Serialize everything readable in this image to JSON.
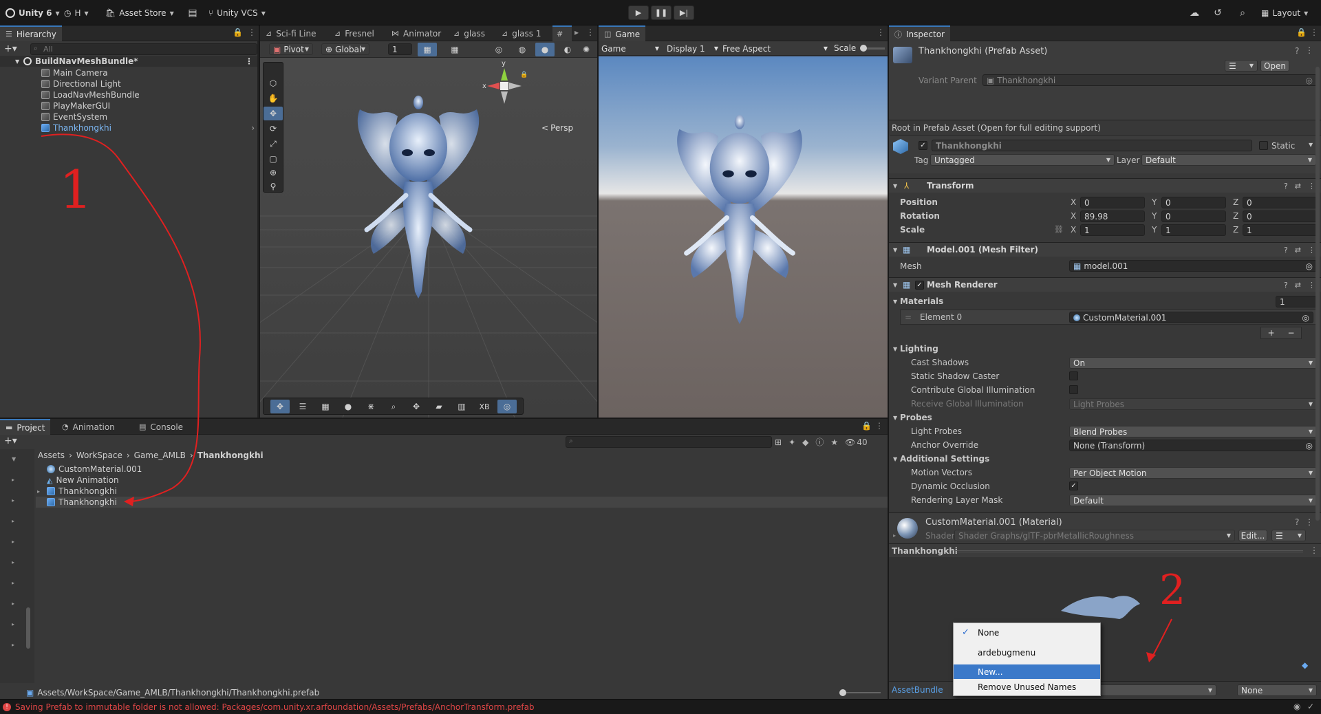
{
  "topbar": {
    "unity_label": "Unity 6",
    "account_label": "H",
    "asset_store": "Asset Store",
    "vcs_label": "Unity VCS",
    "layout_label": "Layout"
  },
  "hierarchy": {
    "tab_label": "Hierarchy",
    "search_placeholder": "All",
    "scene_name": "BuildNavMeshBundle*",
    "items": [
      {
        "label": "Main Camera"
      },
      {
        "label": "Directional Light"
      },
      {
        "label": "LoadNavMeshBundle"
      },
      {
        "label": "PlayMakerGUI"
      },
      {
        "label": "EventSystem"
      },
      {
        "label": "Thankhongkhi"
      }
    ]
  },
  "scene_tabs": [
    "Sci-fi Line",
    "Fresnel",
    "Animator",
    "glass",
    "glass 1"
  ],
  "scene": {
    "pivot": "Pivot",
    "global": "Global",
    "grid_value": "1",
    "persp_label": "Persp",
    "gizmo_y": "y",
    "gizmo_x": "x",
    "bottom_tools_label": "XB"
  },
  "game": {
    "tab_label": "Game",
    "mode": "Game",
    "display": "Display 1",
    "aspect": "Free Aspect",
    "scale_label": "Scale"
  },
  "project": {
    "tabs": [
      "Project",
      "Animation",
      "Console"
    ],
    "count": "40",
    "breadcrumb": [
      "Assets",
      "WorkSpace",
      "Game_AMLB",
      "Thankhongkhi"
    ],
    "files": [
      {
        "label": "CustomMaterial.001"
      },
      {
        "label": "New Animation"
      },
      {
        "label": "Thankhongkhi"
      },
      {
        "label": "Thankhongkhi"
      }
    ],
    "path": "Assets/WorkSpace/Game_AMLB/Thankhongkhi/Thankhongkhi.prefab"
  },
  "annotations": {
    "one": "1",
    "two": "2"
  },
  "inspector": {
    "tab_label": "Inspector",
    "title": "Thankhongkhi (Prefab Asset)",
    "open_button": "Open",
    "variant_parent_label": "Variant Parent",
    "variant_parent_value": "Thankhongkhi",
    "root_note": "Root in Prefab Asset (Open for full editing support)",
    "object_name": "Thankhongkhi",
    "static_label": "Static",
    "tag_label": "Tag",
    "tag_value": "Untagged",
    "layer_label": "Layer",
    "layer_value": "Default",
    "transform": {
      "title": "Transform",
      "position_label": "Position",
      "rotation_label": "Rotation",
      "scale_label": "Scale",
      "position": [
        "0",
        "0",
        "0"
      ],
      "rotation": [
        "89.98",
        "0",
        "0"
      ],
      "scale": [
        "1",
        "1",
        "1"
      ]
    },
    "mesh_filter": {
      "title": "Model.001 (Mesh Filter)",
      "mesh_label": "Mesh",
      "mesh_value": "model.001"
    },
    "mesh_renderer": {
      "title": "Mesh Renderer",
      "materials_label": "Materials",
      "materials_count": "1",
      "element_label": "Element 0",
      "element_value": "CustomMaterial.001",
      "lighting_label": "Lighting",
      "cast_shadows_label": "Cast Shadows",
      "cast_shadows_value": "On",
      "static_shadow_label": "Static Shadow Caster",
      "contribute_gi_label": "Contribute Global Illumination",
      "receive_gi_label": "Receive Global Illumination",
      "receive_gi_value": "Light Probes",
      "probes_label": "Probes",
      "light_probes_label": "Light Probes",
      "light_probes_value": "Blend Probes",
      "anchor_override_label": "Anchor Override",
      "anchor_override_value": "None (Transform)",
      "additional_label": "Additional Settings",
      "motion_vectors_label": "Motion Vectors",
      "motion_vectors_value": "Per Object Motion",
      "dynamic_occlusion_label": "Dynamic Occlusion",
      "rendering_layer_label": "Rendering Layer Mask",
      "rendering_layer_value": "Default"
    },
    "material": {
      "title": "CustomMaterial.001 (Material)",
      "shader_label": "Shader",
      "shader_value": "Shader Graphs/glTF-pbrMetallicRoughness",
      "edit_button": "Edit..."
    },
    "preview_title": "Thankhongkhi",
    "assetbundle_label": "AssetBundle",
    "assetbundle_variant": "None"
  },
  "context_menu": {
    "items": [
      {
        "label": "None",
        "checked": true
      },
      {
        "label": "ardebugmenu"
      },
      {
        "label": "New..."
      },
      {
        "label": "Remove Unused Names"
      }
    ]
  },
  "status": {
    "message": "Saving Prefab to immutable folder is not allowed: Packages/com.unity.xr.arfoundation/Assets/Prefabs/AnchorTransform.prefab"
  },
  "colors": {
    "accent": "#3a79bb",
    "annotation_red": "#e02020",
    "error_text": "#e04646",
    "selected_blue": "#6aaaf0"
  }
}
